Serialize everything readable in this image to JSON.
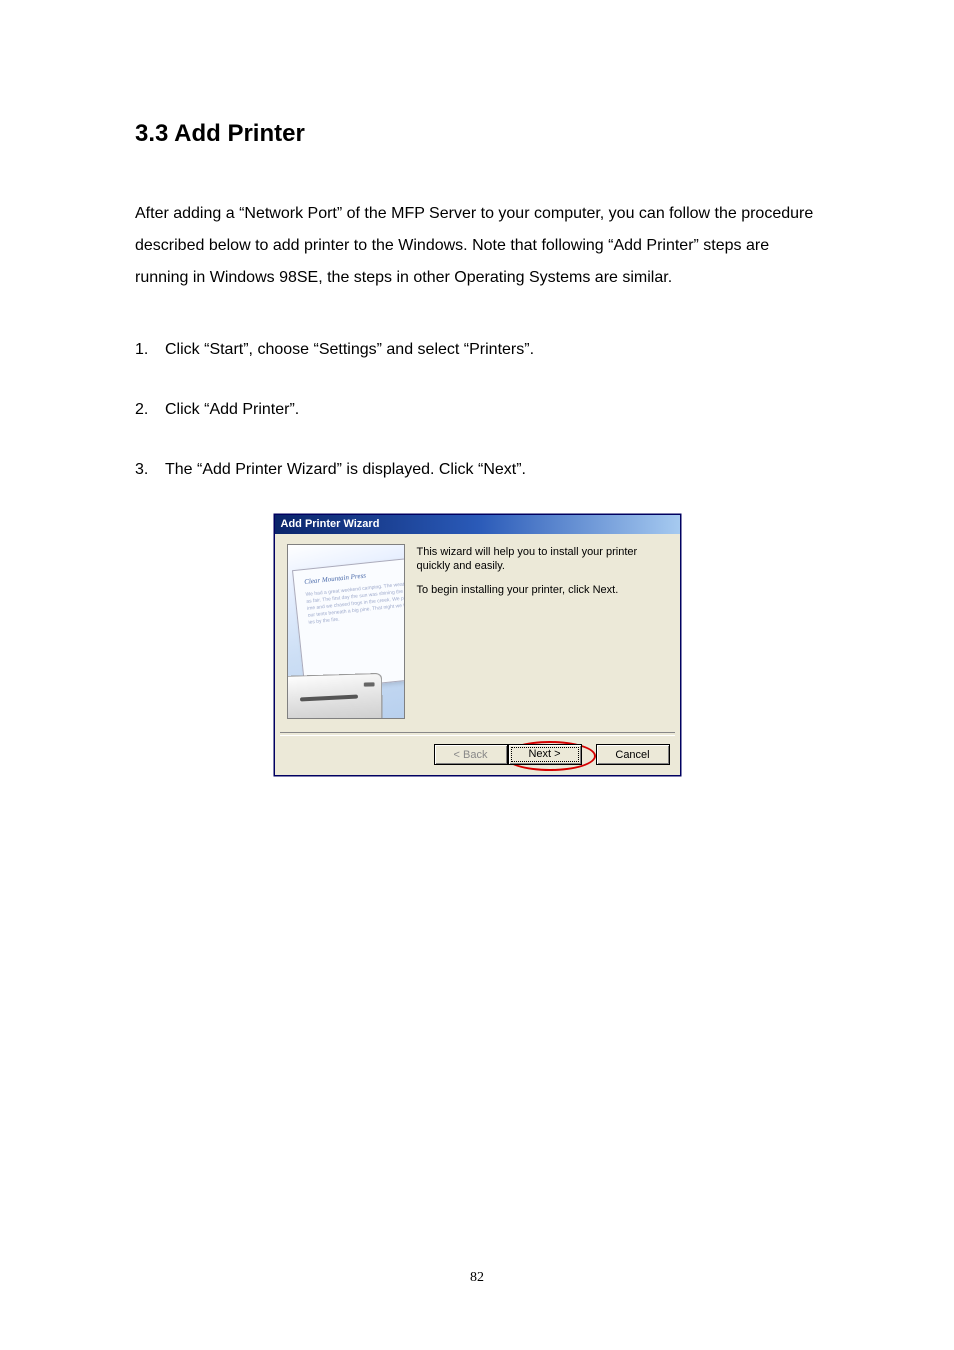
{
  "heading": "3.3 Add Printer",
  "paragraph": "After adding a “Network Port” of the MFP Server to your computer, you can follow the procedure described below to add printer to the Windows. Note that following “Add Printer” steps are running in Windows 98SE, the steps in other Operating Systems are similar.",
  "steps": [
    {
      "num": "1.",
      "text": "Click “Start”, choose “Settings” and select “Printers”."
    },
    {
      "num": "2.",
      "text": "Click “Add Printer”."
    },
    {
      "num": "3.",
      "text": "The “Add Printer Wizard” is displayed. Click “Next”."
    }
  ],
  "wizard": {
    "title": "Add Printer Wizard",
    "line1": "This wizard will help you to install your printer quickly and easily.",
    "line2": "To begin installing your printer, click Next.",
    "btn_back": "< Back",
    "btn_next": "Next >",
    "btn_cancel": "Cancel",
    "paper_heading": "Clear Mountain Press"
  },
  "page_number": "82"
}
